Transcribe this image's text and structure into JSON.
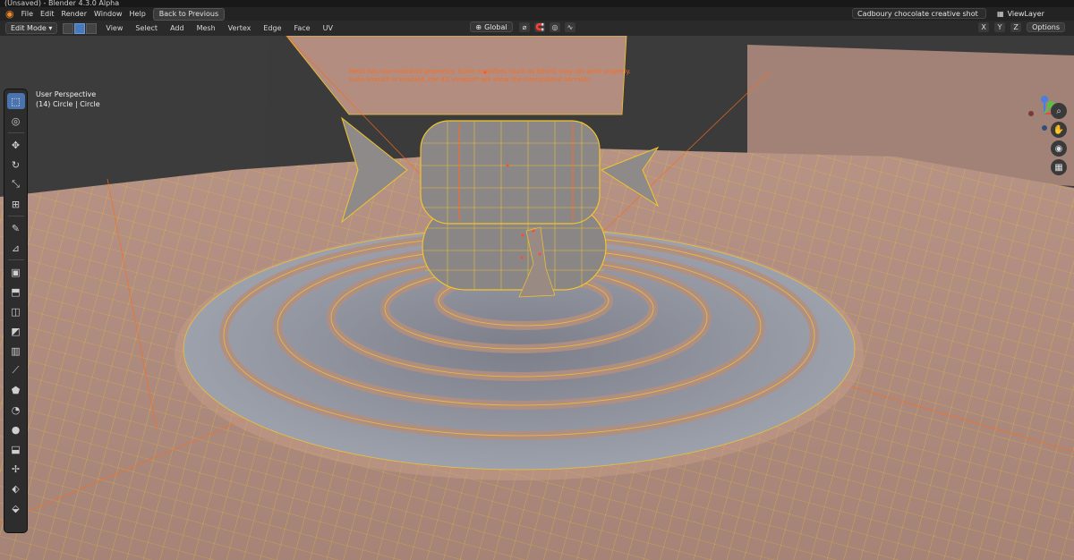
{
  "window": {
    "title": "(Unsaved) - Blender 4.3.0 Alpha",
    "scene_name": "Cadboury chocolate creative shot",
    "view_layer": "ViewLayer"
  },
  "menu": {
    "items": [
      "File",
      "Edit",
      "Render",
      "Window",
      "Help"
    ],
    "back_button": "Back to Previous"
  },
  "header": {
    "mode": "Edit Mode",
    "menus": [
      "View",
      "Select",
      "Add",
      "Mesh",
      "Vertex",
      "Edge",
      "Face",
      "UV"
    ],
    "transform_orientation": "Global",
    "axes": [
      "X",
      "Y",
      "Z"
    ],
    "options_label": "Options"
  },
  "viewport": {
    "perspective_label": "User Perspective",
    "object_label": "(14) Circle | Circle",
    "warning_lines": [
      "Mesh has non-manifold geometry. Some modifiers (such as Bevel) may not work properly.",
      "Auto-Smooth is enabled, the 3D viewport will show the interpolated normals."
    ],
    "colors": {
      "mesh_fill": "#ad8a7d",
      "wire": "#f2c52a",
      "active_edge": "#ff6b1a",
      "ripple": "#8c8f9b",
      "candy": "#8b8686",
      "background": "#3b3b3b"
    }
  },
  "toolbar": {
    "tools": [
      "select-box-icon",
      "cursor-icon",
      "move-icon",
      "rotate-icon",
      "scale-icon",
      "transform-icon",
      "annotate-icon",
      "measure-icon",
      "add-cube-icon",
      "extrude-region-icon",
      "inset-faces-icon",
      "bevel-icon",
      "loop-cut-icon",
      "knife-icon",
      "poly-build-icon",
      "spin-icon",
      "smooth-icon",
      "edge-slide-icon",
      "shrink-fatten-icon",
      "shear-icon",
      "rip-region-icon"
    ]
  }
}
